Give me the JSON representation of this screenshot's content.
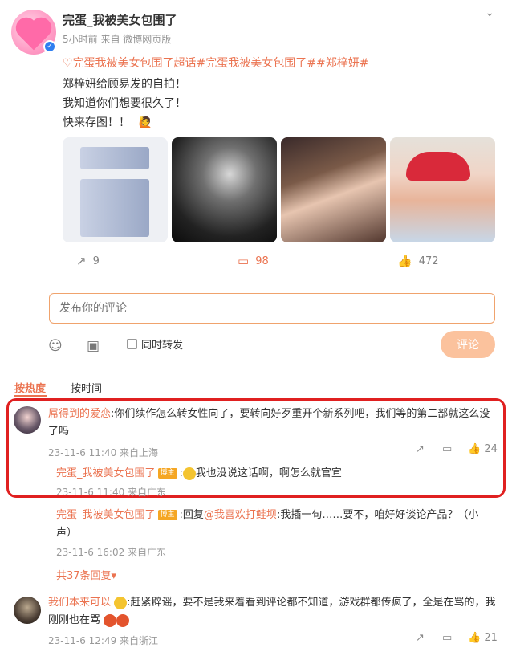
{
  "post": {
    "author": "完蛋_我被美女包围了",
    "meta": "5小时前  来自 微博网页版",
    "topics": "完蛋我被美女包围了超话#完蛋我被美女包围了##郑梓妍#",
    "lines": [
      "郑梓妍给顾易发的自拍！",
      "我知道你们想要很久了！",
      "快来存图！！"
    ],
    "stats": {
      "reposts": "9",
      "comments": "98",
      "likes": "472"
    }
  },
  "composer": {
    "placeholder": "发布你的评论",
    "sync_label": "同时转发",
    "submit_label": "评论"
  },
  "sort": {
    "hot": "按热度",
    "time": "按时间"
  },
  "comments": [
    {
      "user": "屌得到的爱恋",
      "text": ":你们续作怎么转女性向了，要转向好歹重开个新系列吧，我们等的第二部就这么没了吗",
      "meta": "23-11-6 11:40 来自上海",
      "likes": "24",
      "replies": [
        {
          "user": "完蛋_我被美女包围了",
          "badge": "博主",
          "text": "我也没说这话啊，啊怎么就官宣",
          "meta": "23-11-6 11:40 来自广东"
        },
        {
          "user": "完蛋_我被美女包围了",
          "badge": "博主",
          "text_prefix": ":回复",
          "mention": "@我喜欢打鲑坝",
          "text": ":我插一句……要不，咱好好谈论产品？（小声）",
          "meta": "23-11-6 16:02 来自广东"
        }
      ],
      "more": "共37条回复"
    },
    {
      "user": "我们本来可以",
      "text": ":赶紧辟谣，要不是我来着看到评论都不知道，游戏群都传疯了，全是在骂的，我刚刚也在骂",
      "meta": "23-11-6 12:49 来自浙江",
      "likes": "21"
    }
  ],
  "colors": {
    "accent": "#eb7350",
    "highlight": "#e02020"
  }
}
